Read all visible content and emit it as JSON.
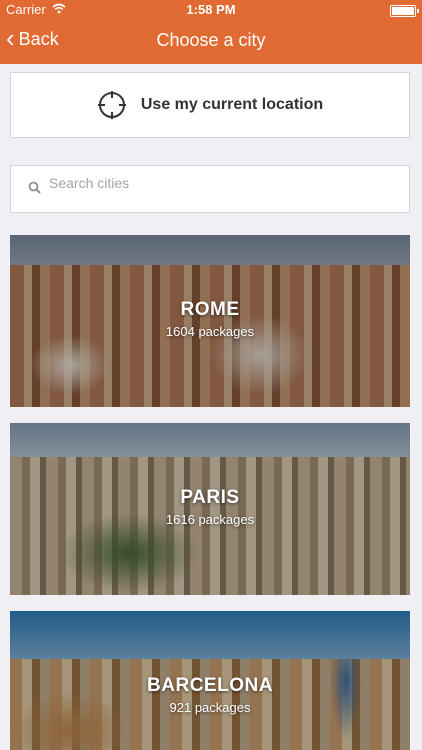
{
  "status_bar": {
    "carrier": "Carrier",
    "time": "1:58 PM"
  },
  "nav": {
    "back_label": "Back",
    "title": "Choose a city"
  },
  "location": {
    "label": "Use my current location",
    "icon": "crosshair-icon"
  },
  "search": {
    "placeholder": "Search cities",
    "value": "",
    "icon": "search-icon"
  },
  "cities": [
    {
      "name": "ROME",
      "packages": "1604 packages"
    },
    {
      "name": "PARIS",
      "packages": "1616 packages"
    },
    {
      "name": "BARCELONA",
      "packages": "921 packages"
    }
  ],
  "colors": {
    "accent": "#e06a32",
    "background": "#efeff4"
  }
}
